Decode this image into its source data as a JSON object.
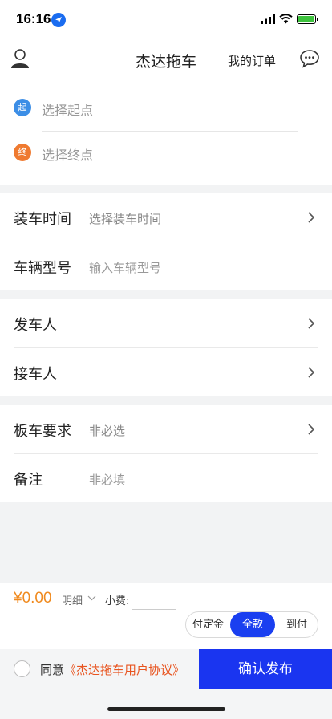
{
  "status_bar": {
    "time": "16:16"
  },
  "nav": {
    "title": "杰达拖车",
    "orders_label": "我的订单",
    "left_icon": "user-icon",
    "right_icon": "chat-icon"
  },
  "address": {
    "start_badge": "起",
    "start_placeholder": "选择起点",
    "end_badge": "终",
    "end_placeholder": "选择终点"
  },
  "form": {
    "load_time_label": "装车时间",
    "load_time_value": "选择装车时间",
    "vehicle_model_label": "车辆型号",
    "vehicle_model_placeholder": "输入车辆型号",
    "sender_label": "发车人",
    "receiver_label": "接车人",
    "truck_req_label": "板车要求",
    "truck_req_value": "非必选",
    "remark_label": "备注",
    "remark_value": "非必填"
  },
  "price": {
    "amount": "¥0.00",
    "detail_label": "明细",
    "tip_label": "小费:",
    "pay_options": [
      "付定金",
      "全款",
      "到付"
    ],
    "selected_option": "全款"
  },
  "footer": {
    "agree_prefix": "同意",
    "agreement_link": "《杰达拖车用户协议》",
    "confirm_label": "确认发布"
  },
  "colors": {
    "accent": "#1a35f0",
    "price": "#f08a1e",
    "link": "#e8541f",
    "start_dot": "#3c8ee6",
    "end_dot": "#ef7a30"
  }
}
